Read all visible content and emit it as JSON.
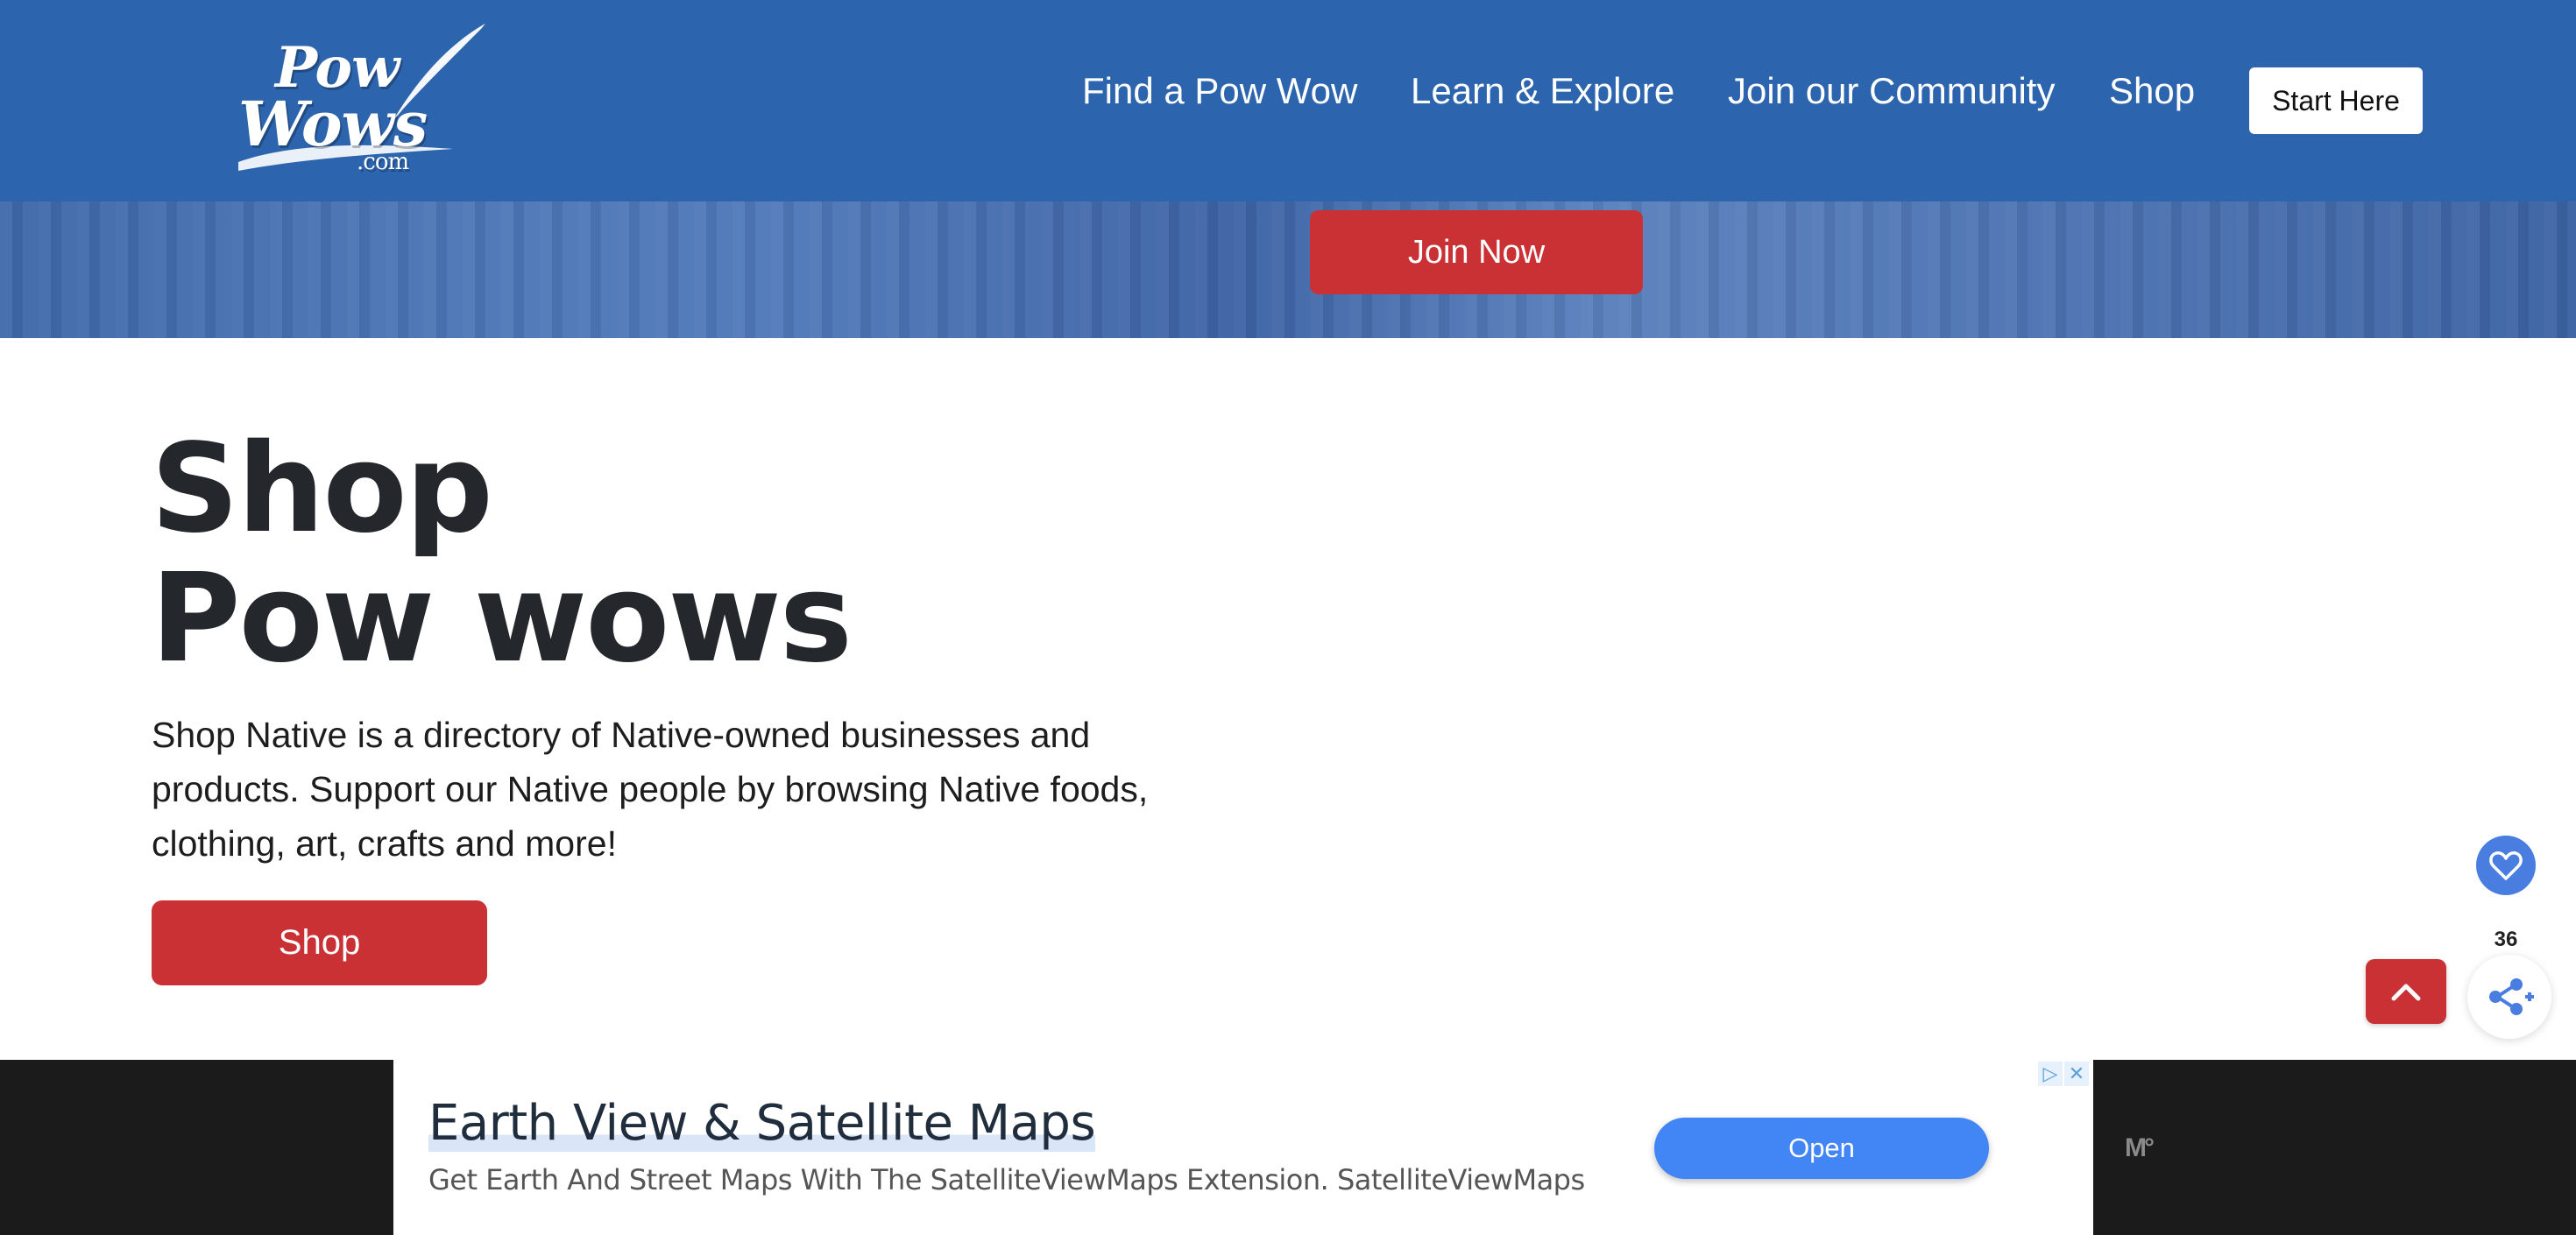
{
  "header": {
    "logo": {
      "line1": "Pow",
      "line2": "Wows",
      "line3": ".com"
    },
    "nav": [
      {
        "label": "Find a Pow Wow"
      },
      {
        "label": "Learn & Explore"
      },
      {
        "label": "Join our Community"
      },
      {
        "label": "Shop"
      }
    ],
    "start_label": "Start Here"
  },
  "hero": {
    "join_label": "Join Now"
  },
  "main": {
    "title_line1": "Shop",
    "title_line2": "Pow wows",
    "description": "Shop Native is a directory of Native-owned businesses and products.  Support our Native people by browsing Native foods, clothing, art, crafts and more!",
    "shop_label": "Shop"
  },
  "widgets": {
    "heart_icon": "heart-icon",
    "share_count": "36",
    "scroll_icon": "chevron-up-icon",
    "share_icon": "share-icon"
  },
  "ad": {
    "title": "Earth View & Satellite Maps",
    "subtitle": "Get Earth And Street Maps With The SatelliteViewMaps Extension. SatelliteViewMaps",
    "open_label": "Open",
    "mv_logo": "M°"
  },
  "colors": {
    "header_blue": "#2c64ae",
    "cta_red": "#c93135",
    "ad_button_blue": "#4285f4"
  }
}
